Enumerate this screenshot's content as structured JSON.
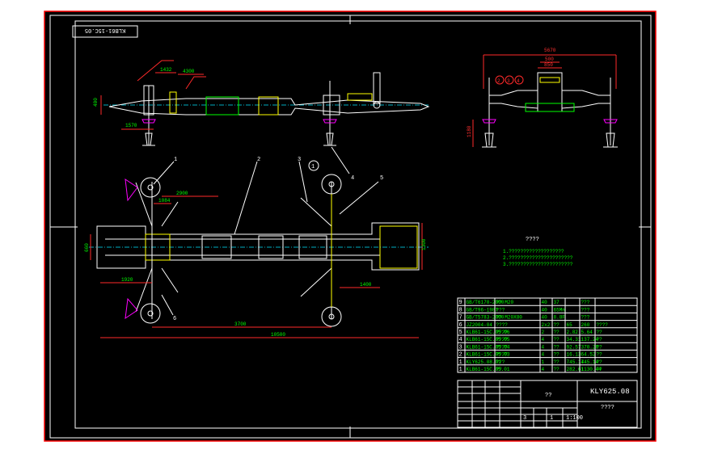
{
  "drawing": {
    "stamp": "KLB61-15C.05",
    "title_code": "KLY625.08",
    "title_name": "??",
    "sub_title": "????",
    "notes_title": "????",
    "notes": [
      "1.???????????????????",
      "2.??????????????????????",
      "3.??????????????????????"
    ],
    "balloons": [
      "1",
      "2",
      "3",
      "4",
      "5",
      "6"
    ],
    "circled": [
      "1",
      "2",
      "3",
      "4"
    ],
    "dims": {
      "top_a": "5670",
      "top_b": "500",
      "top_c": "850",
      "left_h": "1180",
      "plan_a": "2900",
      "plan_b": "1084",
      "plan_c": "1920",
      "plan_d": "3700",
      "plan_e": "10500",
      "plan_f": "1400",
      "plan_g": "1300",
      "plan_h": "660",
      "side_a": "1570",
      "side_b": "400",
      "side_c": "1432",
      "side_d": "4300"
    },
    "bom": [
      [
        "9",
        "GB/T6170-2000",
        "?? M20",
        "40",
        "37",
        "",
        "???"
      ],
      [
        "8",
        "GB/T96-1987",
        "???",
        "40",
        "65Mn",
        "",
        "???"
      ],
      [
        "7",
        "GB/T5783-2000",
        "?? M20X80",
        "40",
        "8.8F",
        "",
        "???"
      ],
      [
        "6",
        "JZ2004-04",
        "????",
        "2x2",
        "??",
        "65",
        "260",
        "????"
      ],
      [
        "5",
        "KLB61-15C.05.06",
        "????",
        "2",
        "??",
        "2.82",
        "5.64",
        "??"
      ],
      [
        "4",
        "KLB61-15C.05.05",
        "????",
        "4",
        "??",
        "34.31",
        "137.24",
        "??"
      ],
      [
        "3",
        "KLB61-15C.05.04",
        "????",
        "4",
        "??",
        "92.57",
        "370.28",
        "??"
      ],
      [
        "2",
        "KLB61-15C.05.03",
        "????",
        "4",
        "??",
        "16.13",
        "64.52",
        "??"
      ],
      [
        "1",
        "KLY625.08.01",
        "???",
        "1",
        "??",
        "745.14",
        "745.14",
        "??"
      ],
      [
        "1",
        "KLB61-15C.05.01",
        "??",
        "4",
        "??",
        "282.61",
        "1130.44",
        "??"
      ]
    ],
    "title_cells": [
      "1",
      "1:100"
    ],
    "sheet_num": "3"
  }
}
